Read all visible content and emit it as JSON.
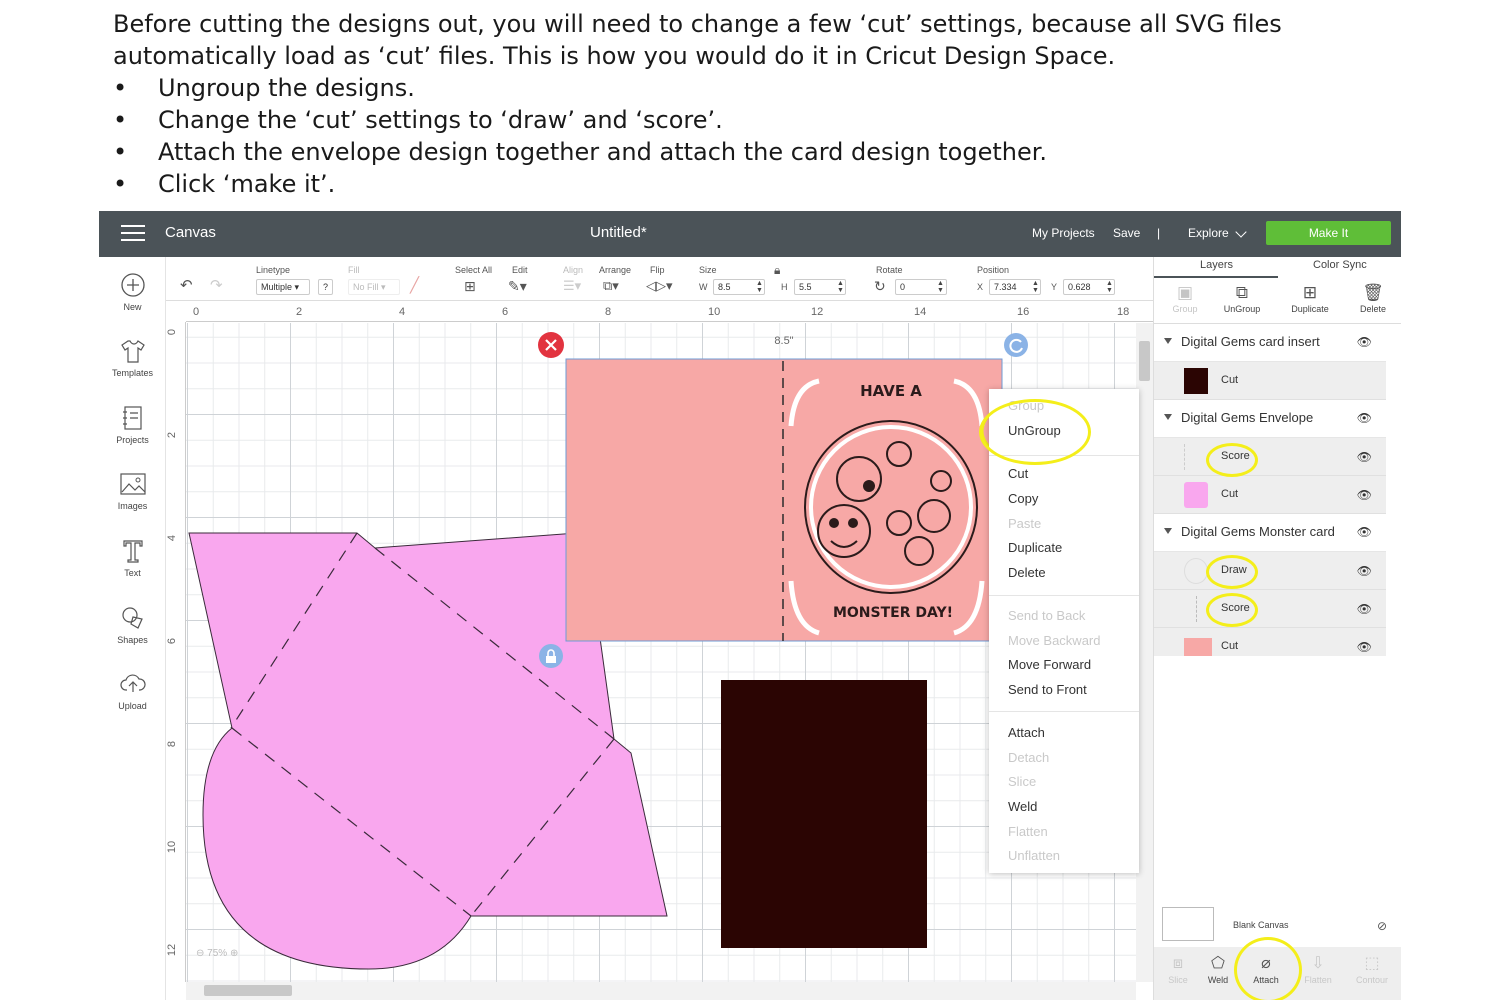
{
  "instructions": {
    "paragraph": "Before cutting the designs out, you will need to change a few ‘cut’ settings, because all SVG files automatically load as ‘cut’ files. This is how you would do it in Cricut Design Space.",
    "bullet_symbol": "•",
    "bullets": [
      "Ungroup the designs.",
      "Change the ‘cut’ settings to ‘draw’ and ‘score’.",
      "Attach the envelope design together and attach the card design together.",
      "Click ‘make it’."
    ]
  },
  "topbar": {
    "section": "Canvas",
    "doc_title": "Untitled*",
    "my_projects": "My Projects",
    "save": "Save",
    "separator": "|",
    "explore": "Explore",
    "make_it": "Make It"
  },
  "toolbar": {
    "linetype_label": "Linetype",
    "linetype_value": "Multiple",
    "linetype_help": "?",
    "fill_label": "Fill",
    "fill_value": "No Fill",
    "select_all": "Select All",
    "edit": "Edit",
    "align": "Align",
    "arrange": "Arrange",
    "flip": "Flip",
    "size_label": "Size",
    "w_label": "W",
    "w_value": "8.5",
    "h_label": "H",
    "h_value": "5.5",
    "rotate_label": "Rotate",
    "rotate_value": "0",
    "position_label": "Position",
    "x_label": "X",
    "x_value": "7.334",
    "y_label": "Y",
    "y_value": "0.628"
  },
  "leftnav": [
    {
      "label": "New",
      "icon": "plus-circle-icon"
    },
    {
      "label": "Templates",
      "icon": "shirt-icon"
    },
    {
      "label": "Projects",
      "icon": "projects-icon"
    },
    {
      "label": "Images",
      "icon": "image-icon"
    },
    {
      "label": "Text",
      "icon": "text-icon"
    },
    {
      "label": "Shapes",
      "icon": "shapes-icon"
    },
    {
      "label": "Upload",
      "icon": "upload-icon"
    }
  ],
  "canvas": {
    "h_ruler": [
      "0",
      "2",
      "4",
      "6",
      "8",
      "10",
      "12",
      "14",
      "16",
      "18"
    ],
    "v_ruler": [
      "0",
      "2",
      "4",
      "6",
      "8",
      "10",
      "12"
    ],
    "width_tag": "8.5\"",
    "card_text_top": "HAVE A",
    "card_text_bottom": "MONSTER DAY!",
    "zoom": "75%",
    "colors": {
      "card": "#f7a8a6",
      "envelope": "#f9a7ee",
      "insert": "#2b0503",
      "highlight": "#f4ee1a"
    }
  },
  "context_menu": {
    "items": [
      {
        "label": "Group",
        "enabled": false
      },
      {
        "label": "UnGroup",
        "enabled": true
      },
      {
        "label": "Cut",
        "enabled": true
      },
      {
        "label": "Copy",
        "enabled": true
      },
      {
        "label": "Paste",
        "enabled": false
      },
      {
        "label": "Duplicate",
        "enabled": true
      },
      {
        "label": "Delete",
        "enabled": true
      },
      {
        "label": "Send to Back",
        "enabled": false
      },
      {
        "label": "Move Backward",
        "enabled": false
      },
      {
        "label": "Move Forward",
        "enabled": true
      },
      {
        "label": "Send to Front",
        "enabled": true
      },
      {
        "label": "Attach",
        "enabled": true
      },
      {
        "label": "Detach",
        "enabled": false
      },
      {
        "label": "Slice",
        "enabled": false
      },
      {
        "label": "Weld",
        "enabled": true
      },
      {
        "label": "Flatten",
        "enabled": false
      },
      {
        "label": "Unflatten",
        "enabled": false
      }
    ]
  },
  "panel": {
    "tabs": [
      "Layers",
      "Color Sync"
    ],
    "tools": [
      {
        "label": "Group",
        "enabled": false
      },
      {
        "label": "UnGroup",
        "enabled": true
      },
      {
        "label": "Duplicate",
        "enabled": true
      },
      {
        "label": "Delete",
        "enabled": true
      }
    ],
    "groups": [
      {
        "name": "Digital Gems card insert",
        "layers": [
          {
            "op": "Cut",
            "color": "#2b0503"
          }
        ]
      },
      {
        "name": "Digital Gems Envelope",
        "layers": [
          {
            "op": "Score",
            "color": "#ffffff"
          },
          {
            "op": "Cut",
            "color": "#f9a7ee"
          }
        ]
      },
      {
        "name": "Digital Gems Monster card",
        "layers": [
          {
            "op": "Draw",
            "color": "#ffffff"
          },
          {
            "op": "Score",
            "color": "#ffffff"
          },
          {
            "op": "Cut",
            "color": "#f7a8a6"
          }
        ]
      }
    ],
    "blank_canvas": "Blank Canvas",
    "bottom_tools": [
      {
        "label": "Slice",
        "enabled": false
      },
      {
        "label": "Weld",
        "enabled": true
      },
      {
        "label": "Attach",
        "enabled": true
      },
      {
        "label": "Flatten",
        "enabled": false
      },
      {
        "label": "Contour",
        "enabled": false
      }
    ]
  }
}
